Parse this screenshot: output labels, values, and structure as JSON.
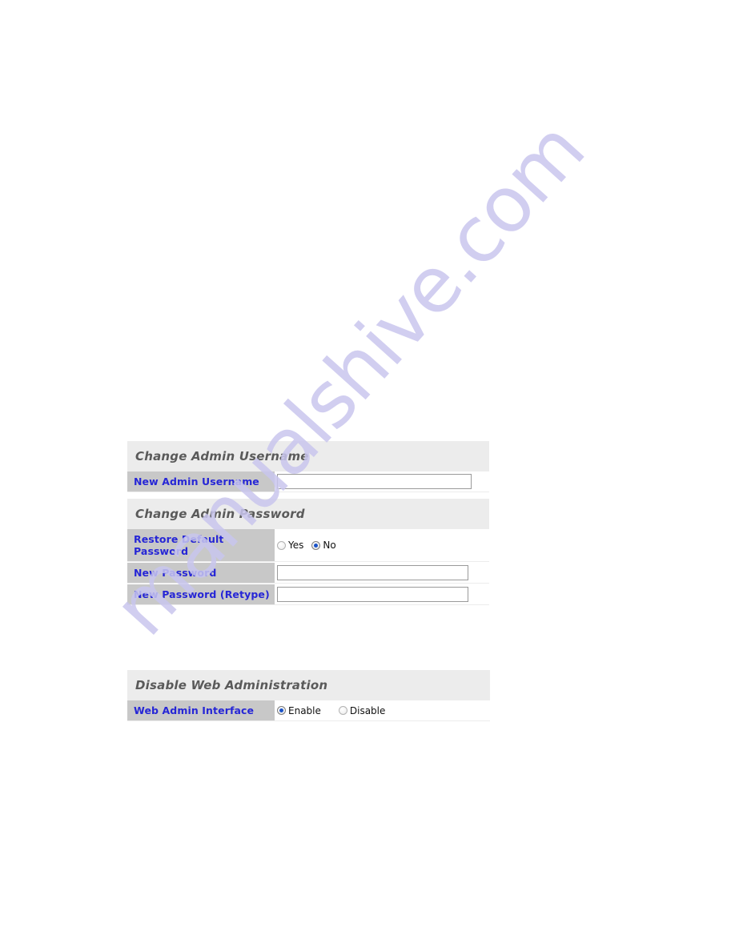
{
  "page": {
    "background_color": "#ffffff",
    "watermark_text": "manualshive.com",
    "watermark_color": "#c9c6ee"
  },
  "colors": {
    "panel_background": "#ececec",
    "label_cell_background": "#c8c8c8",
    "label_text": "#2626d6",
    "panel_title_text": "#5a5a5a",
    "field_background": "#ffffff",
    "radio_dot": "#1a53c8",
    "input_border": "#9a9a9a"
  },
  "sections": [
    {
      "id": "change-admin-username",
      "title": "Change Admin Username",
      "rows": [
        {
          "label": "New Admin Username",
          "control": "text",
          "value": "",
          "placeholder": ""
        }
      ]
    },
    {
      "id": "change-admin-password",
      "title": "Change Admin Password",
      "rows": [
        {
          "label": "Restore Default Password",
          "control": "radio",
          "options": [
            "Yes",
            "No"
          ],
          "selected": "No"
        },
        {
          "label": "New Password",
          "control": "text",
          "value": "",
          "placeholder": ""
        },
        {
          "label": "New Password (Retype)",
          "control": "text",
          "value": "",
          "placeholder": ""
        }
      ]
    },
    {
      "id": "disable-web-administration",
      "title": "Disable Web Administration",
      "rows": [
        {
          "label": "Web Admin Interface",
          "control": "radio",
          "options": [
            "Enable",
            "Disable"
          ],
          "selected": "Enable"
        }
      ]
    }
  ]
}
